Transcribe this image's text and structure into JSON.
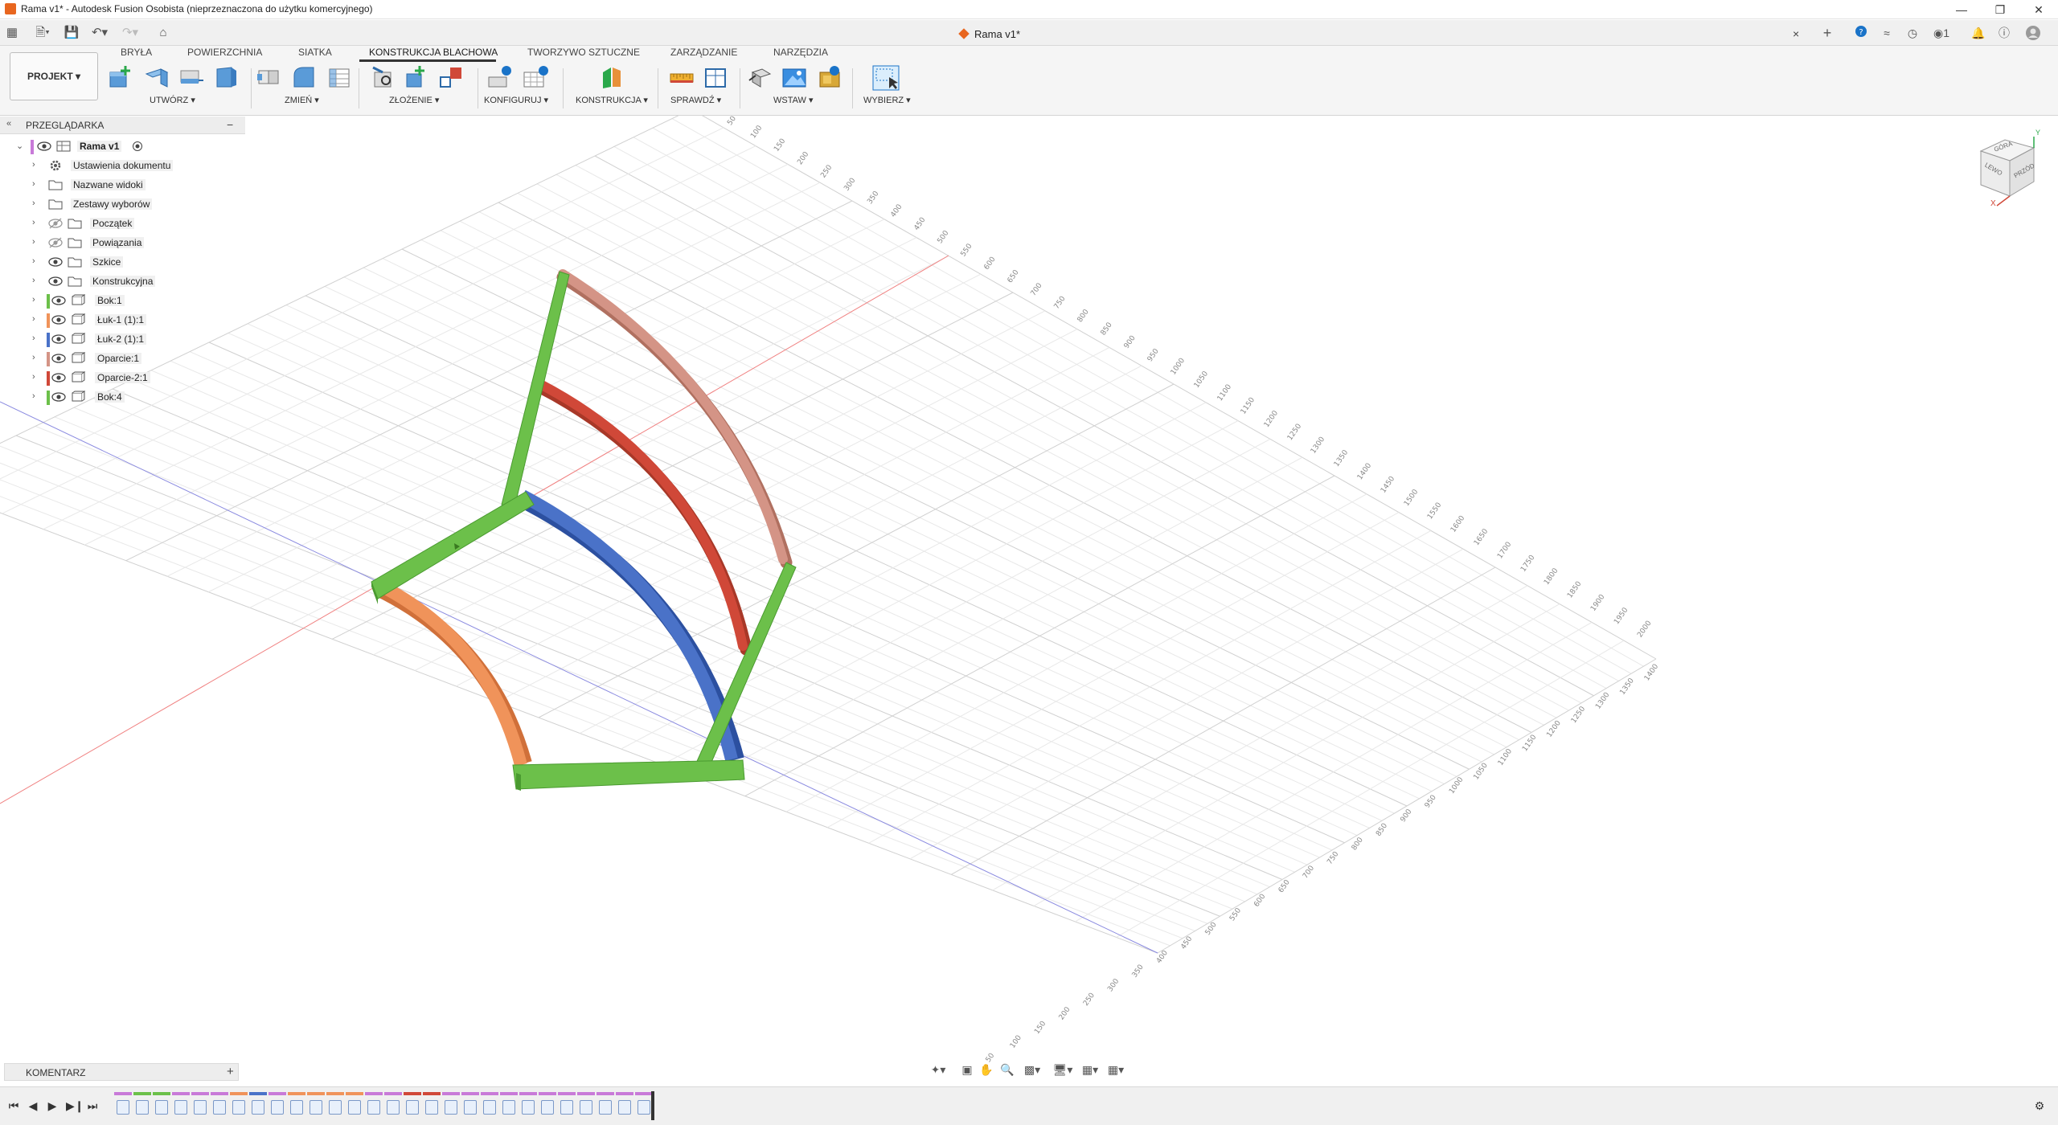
{
  "window": {
    "title": "Rama v1* - Autodesk Fusion Osobista (nieprzeznaczona do użytku komercyjnego)",
    "minimize": "—",
    "restore": "❐",
    "close": "✕"
  },
  "document_tab": {
    "title": "Rama v1*",
    "close": "×"
  },
  "header_right": {
    "new_tab": "+",
    "jobs_count": "1"
  },
  "ribbon": {
    "workspace_button": "PROJEKT ▾",
    "tabs": [
      {
        "label": "BRYŁA",
        "active": false
      },
      {
        "label": "POWIERZCHNIA",
        "active": false
      },
      {
        "label": "SIATKA",
        "active": false
      },
      {
        "label": "KONSTRUKCJA BLACHOWA",
        "active": true
      },
      {
        "label": "TWORZYWO SZTUCZNE",
        "active": false
      },
      {
        "label": "ZARZĄDZANIE",
        "active": false
      },
      {
        "label": "NARZĘDZIA",
        "active": false
      }
    ],
    "groups": [
      {
        "label": "UTWÓRZ ▾"
      },
      {
        "label": "ZMIEŃ ▾"
      },
      {
        "label": "ZŁOŻENIE ▾"
      },
      {
        "label": "KONFIGURUJ ▾"
      },
      {
        "label": "KONSTRUKCJA ▾"
      },
      {
        "label": "SPRAWDŹ ▾"
      },
      {
        "label": "WSTAW ▾"
      },
      {
        "label": "WYBIERZ ▾"
      }
    ]
  },
  "browser": {
    "title": "PRZEGLĄDARKA",
    "collapse": "−",
    "root": "Rama v1",
    "items": [
      {
        "label": "Ustawienia dokumentu",
        "icon": "gear-icon",
        "color": ""
      },
      {
        "label": "Nazwane widoki",
        "icon": "folder-icon",
        "color": ""
      },
      {
        "label": "Zestawy wyborów",
        "icon": "folder-icon",
        "color": ""
      },
      {
        "label": "Początek",
        "icon": "folder-icon",
        "color": ""
      },
      {
        "label": "Powiązania",
        "icon": "folder-icon",
        "color": ""
      },
      {
        "label": "Szkice",
        "icon": "folder-icon",
        "color": ""
      },
      {
        "label": "Konstrukcyjna",
        "icon": "folder-icon",
        "color": ""
      },
      {
        "label": "Bok:1",
        "icon": "component-icon",
        "color": "#6cc04a"
      },
      {
        "label": "Łuk-1 (1):1",
        "icon": "component-icon",
        "color": "#f0935a"
      },
      {
        "label": "Łuk-2 (1):1",
        "icon": "component-icon",
        "color": "#4a72c8"
      },
      {
        "label": "Oparcie:1",
        "icon": "component-icon",
        "color": "#d49486"
      },
      {
        "label": "Oparcie-2:1",
        "icon": "component-icon",
        "color": "#d04838"
      },
      {
        "label": "Bok:4",
        "icon": "component-icon",
        "color": "#6cc04a"
      }
    ]
  },
  "comments": {
    "title": "KOMENTARZ",
    "add": "+"
  },
  "viewcube": {
    "top": "GÓRA",
    "left": "LEWO",
    "front": "PRZÓD",
    "axis_x": "X",
    "axis_y": "Y"
  },
  "ruler_back": [
    "50",
    "100",
    "150",
    "200",
    "250",
    "300",
    "350",
    "400",
    "450",
    "500",
    "550",
    "600",
    "650",
    "700",
    "750",
    "800",
    "850",
    "900",
    "950",
    "1000",
    "1050",
    "1100",
    "1150",
    "1200",
    "1250",
    "1300",
    "1350",
    "1400",
    "1450",
    "1500",
    "1550",
    "1600",
    "1650",
    "1700",
    "1750",
    "1800",
    "1850",
    "1900",
    "1950",
    "2000"
  ],
  "ruler_front": [
    "50",
    "100",
    "150",
    "200",
    "250",
    "300",
    "350",
    "400",
    "450",
    "500",
    "550",
    "600",
    "650",
    "700",
    "750",
    "800",
    "850",
    "900",
    "950",
    "1000",
    "1050",
    "1100",
    "1150",
    "1200",
    "1250",
    "1300",
    "1350",
    "1400"
  ],
  "colors": {
    "green": "#6cc04a",
    "orange": "#f0935a",
    "blue": "#4a72c8",
    "pink": "#d49486",
    "red": "#d04838",
    "accent": "#0696d7"
  }
}
